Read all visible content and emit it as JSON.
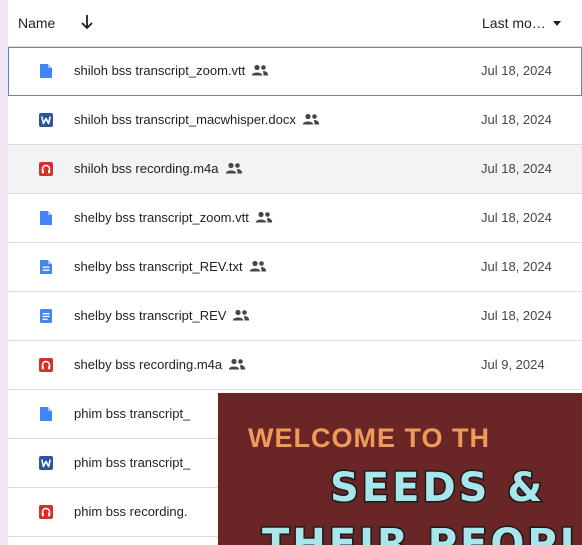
{
  "header": {
    "name_label": "Name",
    "sort_icon": "arrow-down-icon",
    "modified_label": "Last mo…",
    "dropdown_icon": "caret-down-icon"
  },
  "colors": {
    "doc_blue": "#4285f4",
    "word_blue": "#2b579a",
    "audio_red": "#d93025",
    "gdoc_blue": "#4285f4",
    "overlay_bg": "#6a2626",
    "overlay_orange": "#f09a5a",
    "overlay_teal": "#a9e6ec"
  },
  "files": [
    {
      "name": "shiloh bss transcript_zoom.vtt",
      "type": "file",
      "icon": "file-icon",
      "shared": true,
      "date": "Jul 18, 2024"
    },
    {
      "name": "shiloh bss transcript_macwhisper.docx",
      "type": "word",
      "icon": "word-doc-icon",
      "shared": true,
      "date": "Jul 18, 2024"
    },
    {
      "name": "shiloh bss recording.m4a",
      "type": "audio",
      "icon": "audio-file-icon",
      "shared": true,
      "date": "Jul 18, 2024"
    },
    {
      "name": "shelby bss transcript_zoom.vtt",
      "type": "file",
      "icon": "file-icon",
      "shared": true,
      "date": "Jul 18, 2024"
    },
    {
      "name": "shelby bss transcript_REV.txt",
      "type": "text",
      "icon": "text-file-icon",
      "shared": true,
      "date": "Jul 18, 2024"
    },
    {
      "name": "shelby bss transcript_REV",
      "type": "gdoc",
      "icon": "google-doc-icon",
      "shared": true,
      "date": "Jul 18, 2024"
    },
    {
      "name": "shelby bss recording.m4a",
      "type": "audio",
      "icon": "audio-file-icon",
      "shared": true,
      "date": "Jul 9, 2024"
    },
    {
      "name": "phim bss transcript_",
      "type": "file",
      "icon": "file-icon",
      "shared": false,
      "date": ""
    },
    {
      "name": "phim bss transcript_",
      "type": "word",
      "icon": "word-doc-icon",
      "shared": false,
      "date": ""
    },
    {
      "name": "phim bss recording.",
      "type": "audio",
      "icon": "audio-file-icon",
      "shared": false,
      "date": ""
    }
  ],
  "overlay": {
    "line1": "WELCOME TO TH",
    "line2": "SEEDS  &",
    "line3": "THEIR PEOPL"
  }
}
